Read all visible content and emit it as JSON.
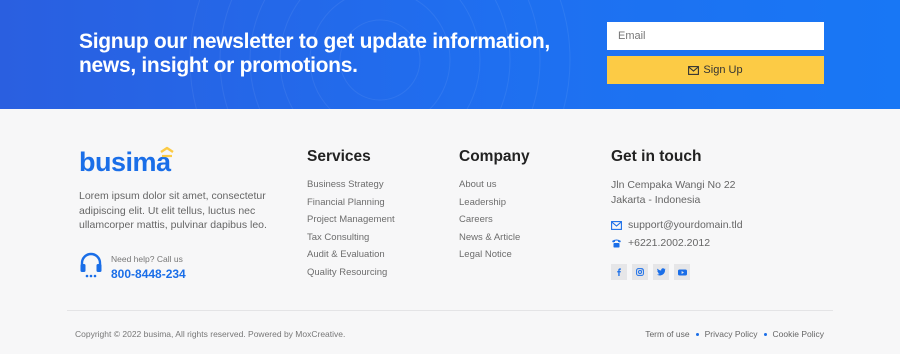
{
  "newsletter": {
    "title": "Signup our newsletter to get update information, news, insight or promotions.",
    "email_placeholder": "Email",
    "signup_label": "Sign Up"
  },
  "brand": {
    "logo_text": "busima",
    "about": "Lorem ipsum dolor sit amet, consectetur adipiscing elit. Ut elit tellus, luctus nec ullamcorper mattis, pulvinar dapibus leo.",
    "help_label": "Need help? Call us",
    "help_phone": "800-8448-234"
  },
  "services": {
    "title": "Services",
    "items": [
      "Business Strategy",
      "Financial Planning",
      "Project Management",
      "Tax Consulting",
      "Audit & Evaluation",
      "Quality Resourcing"
    ]
  },
  "company": {
    "title": "Company",
    "items": [
      "About us",
      "Leadership",
      "Careers",
      "News & Article",
      "Legal Notice"
    ]
  },
  "contact": {
    "title": "Get in touch",
    "address_line1": "Jln Cempaka Wangi No 22",
    "address_line2": "Jakarta - Indonesia",
    "email": "support@yourdomain.tld",
    "phone": "+6221.2002.2012",
    "socials": [
      "facebook-icon",
      "instagram-icon",
      "twitter-icon",
      "youtube-icon"
    ]
  },
  "footer": {
    "copyright": "Copyright © 2022 busima, All rights reserved. Powered by MoxCreative.",
    "links": [
      "Term of use",
      "Privacy Policy",
      "Cookie Policy"
    ]
  },
  "colors": {
    "primary": "#1a6ee8",
    "banner": "#1f6ff0",
    "accent": "#fccb45"
  }
}
